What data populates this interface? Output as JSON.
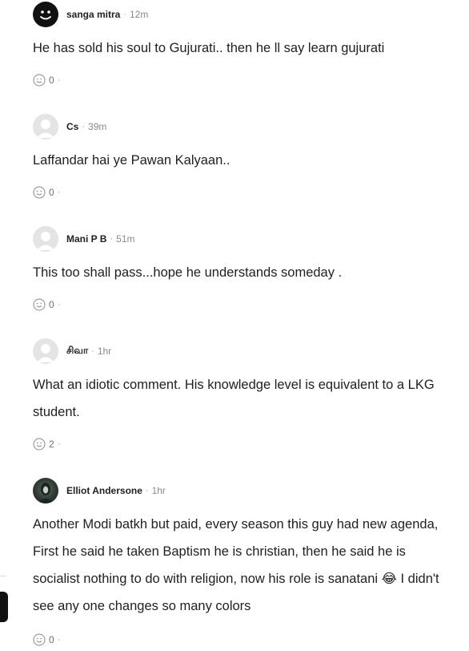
{
  "comments": [
    {
      "name": "sanga mitra",
      "time": "12m",
      "text": "He has sold his soul to Gujurati.. then he ll say learn gujurati",
      "reactions": "0",
      "avatar": "smiley-icon"
    },
    {
      "name": "Cs",
      "time": "39m",
      "text": "Laffandar hai ye Pawan Kalyaan..",
      "reactions": "0",
      "avatar": "default-avatar-icon"
    },
    {
      "name": "Mani P B",
      "time": "51m",
      "text": "This too shall pass...hope he understands someday .",
      "reactions": "0",
      "avatar": "default-avatar-icon"
    },
    {
      "name": "சிவா",
      "time": "1hr",
      "text": "What an idiotic comment. His knowledge level is equivalent to a LKG student.",
      "reactions": "2",
      "avatar": "default-avatar-icon"
    },
    {
      "name": "Elliot Andersone",
      "time": "1hr",
      "text": "Another Modi batkh but paid, every season this guy had new agenda, First he said he taken Baptism he is christian, then he said he is socialist nothing to do with religion, now his role is sanatani 😂 I didn't see any one changes so many colors",
      "reactions": "0",
      "avatar": "photo-avatar"
    }
  ],
  "separator": "·"
}
